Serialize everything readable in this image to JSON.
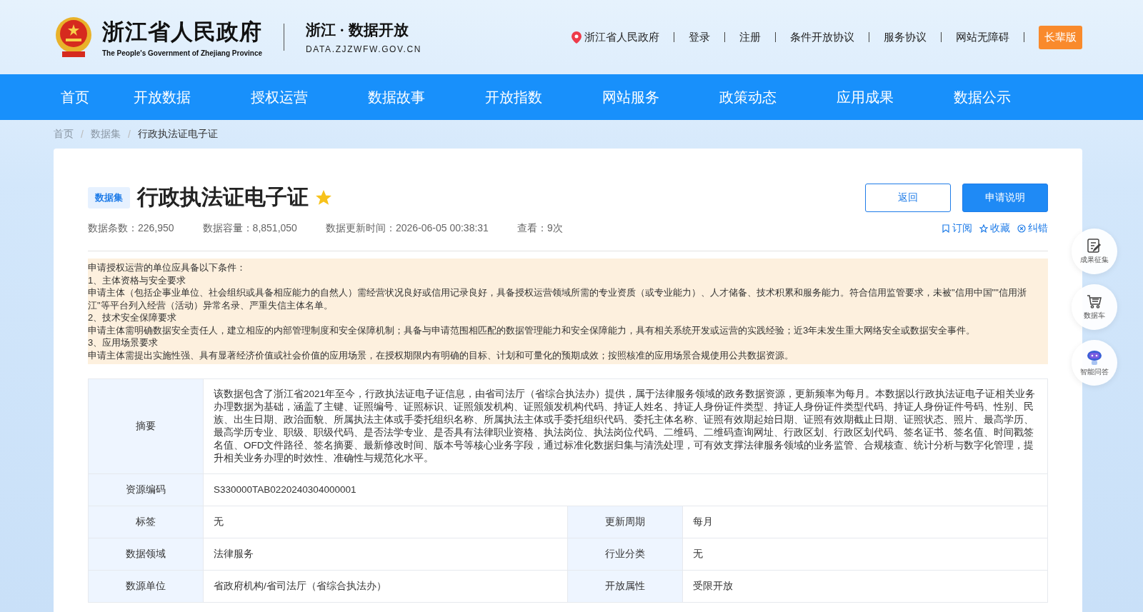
{
  "header": {
    "logo_title": "浙江省人民政府",
    "logo_subtitle": "The People's Government of Zhejiang Province",
    "site_title": "浙江 · 数据开放",
    "site_domain": "DATA.ZJZWFW.GOV.CN",
    "links": [
      {
        "kind": "location",
        "label": "浙江省人民政府"
      },
      {
        "kind": "link",
        "label": "登录"
      },
      {
        "kind": "link",
        "label": "注册"
      },
      {
        "kind": "link",
        "label": "条件开放协议"
      },
      {
        "kind": "link",
        "label": "服务协议"
      },
      {
        "kind": "link",
        "label": "网站无障碍"
      },
      {
        "kind": "button",
        "label": "长辈版"
      }
    ]
  },
  "nav": [
    {
      "label": "首页",
      "selected": false
    },
    {
      "label": "开放数据",
      "selected": false
    },
    {
      "label": "授权运营",
      "selected": false
    },
    {
      "label": "数据故事",
      "selected": false
    },
    {
      "label": "开放指数",
      "selected": false
    },
    {
      "label": "网站服务",
      "selected": false
    },
    {
      "label": "政策动态",
      "selected": false
    },
    {
      "label": "应用成果",
      "selected": false
    },
    {
      "label": "数据公示",
      "selected": false
    }
  ],
  "breadcrumb": [
    {
      "kind": "link",
      "label": "首页"
    },
    {
      "kind": "separator",
      "label": "/"
    },
    {
      "kind": "link",
      "label": "数据集"
    },
    {
      "kind": "separator",
      "label": "/"
    },
    {
      "kind": "current",
      "label": "行政执法证电子证"
    }
  ],
  "dataset": {
    "tag": "数据集",
    "title": "行政执法证电子证",
    "starred": true,
    "buttons": [
      {
        "label": "返回",
        "primary": false
      },
      {
        "label": "申请说明",
        "primary": true
      }
    ],
    "stats": [
      "数据条数：226,950",
      "数据容量：8,851,050",
      "数据更新时间：2026-06-05 00:38:31",
      "查看：9次"
    ],
    "actions": [
      {
        "kind": "subscribe",
        "label": "订阅"
      },
      {
        "kind": "favorite",
        "label": "收藏"
      },
      {
        "kind": "report",
        "label": "纠错"
      }
    ]
  },
  "notice": [
    "申请授权运营的单位应具备以下条件：",
    "1、主体资格与安全要求",
    "申请主体（包括企事业单位、社会组织或具备相应能力的自然人）需经营状况良好或信用记录良好，具备授权运营领域所需的专业资质（或专业能力）、人才储备、技术积累和服务能力。符合信用监管要求，未被\"信用中国\"\"信用浙江\"等平台列入经营（活动）异常名录、严重失信主体名单。",
    "2、技术安全保障要求",
    "申请主体需明确数据安全责任人，建立相应的内部管理制度和安全保障机制；具备与申请范围相匹配的数据管理能力和安全保障能力，具有相关系统开发或运营的实践经验；近3年未发生重大网络安全或数据安全事件。",
    "3、应用场景要求",
    "申请主体需提出实施性强、具有显著经济价值或社会价值的应用场景，在授权期限内有明确的目标、计划和可量化的预期成效；按照核准的应用场景合规使用公共数据资源。"
  ],
  "table": {
    "rows": [
      {
        "cells": [
          {
            "label": "摘要",
            "value": "该数据包含了浙江省2021年至今，行政执法证电子证信息，由省司法厅（省综合执法办）提供，属于法律服务领域的政务数据资源，更新频率为每月。本数据以行政执法证电子证相关业务办理数据为基础，涵盖了主键、证照编号、证照标识、证照颁发机构、证照颁发机构代码、持证人姓名、持证人身份证件类型、持证人身份证件类型代码、持证人身份证件号码、性别、民族、出生日期、政治面貌、所属执法主体或手委托组织名称、所属执法主体或手委托组织代码、委托主体名称、证照有效期起始日期、证照有效期截止日期、证照状态、照片、最高学历、最高学历专业、职级、职级代码、是否法学专业、是否具有法律职业资格、执法岗位、执法岗位代码、二维码、二维码查询网址、行政区划、行政区划代码、签名证书、签名值、时间戳签名值、OFD文件路径、签名摘要、最新修改时间、版本号等核心业务字段，通过标准化数据归集与清洗处理，可有效支撑法律服务领域的业务监管、合规核查、统计分析与数字化管理，提升相关业务办理的时效性、准确性与规范化水平。"
          }
        ]
      },
      {
        "cells": [
          {
            "label": "资源编码",
            "value": "S330000TAB0220240304000001"
          }
        ]
      },
      {
        "cells": [
          {
            "label": "标签",
            "value": "无"
          },
          {
            "label": "更新周期",
            "value": "每月"
          }
        ]
      },
      {
        "cells": [
          {
            "label": "数据领域",
            "value": "法律服务"
          },
          {
            "label": "行业分类",
            "value": "无"
          }
        ]
      },
      {
        "cells": [
          {
            "label": "数源单位",
            "value": "省政府机构/省司法厅（省综合执法办）"
          },
          {
            "label": "开放属性",
            "value": "受限开放"
          }
        ]
      }
    ]
  },
  "float_buttons": [
    {
      "kind": "collect",
      "label": "成果征集"
    },
    {
      "kind": "cart",
      "label": "数据车"
    },
    {
      "kind": "robot",
      "label": "智能问答"
    }
  ]
}
